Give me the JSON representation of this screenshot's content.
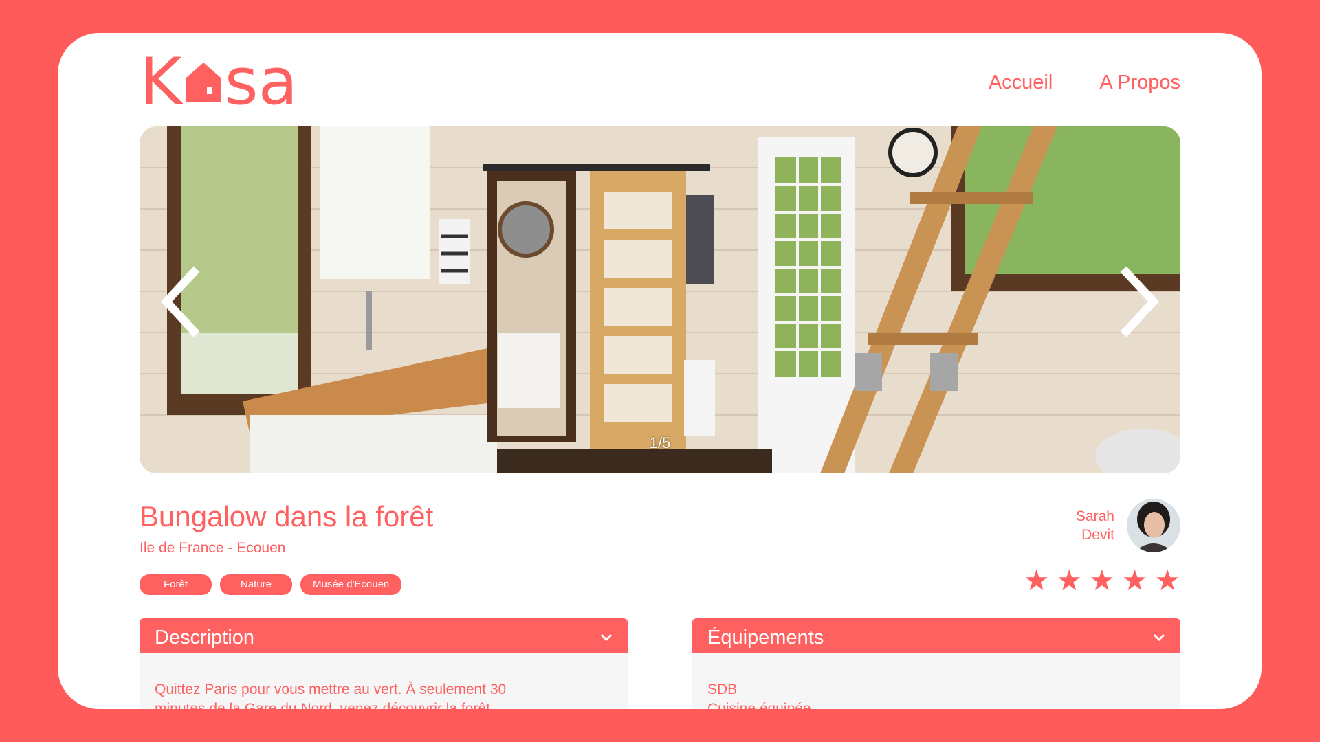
{
  "header": {
    "logo_text": "Kasa",
    "nav": [
      "Accueil",
      "A Propos"
    ]
  },
  "carousel": {
    "counter": "1/5",
    "prev_icon": "chevron-left-icon",
    "next_icon": "chevron-right-icon"
  },
  "listing": {
    "title": "Bungalow dans la forêt",
    "location": "Ile de France - Ecouen",
    "tags": [
      "Forêt",
      "Nature",
      "Musée d'Ecouen"
    ],
    "rating": 5,
    "rating_max": 5
  },
  "host": {
    "first_name": "Sarah",
    "last_name": "Devit"
  },
  "description": {
    "title": "Description",
    "text_line1": "Quittez Paris pour vous mettre au vert. À seulement 30",
    "text_line2": "minutes de la Gare du Nord, venez découvrir la forêt"
  },
  "equipements": {
    "title": "Équipements",
    "items": [
      "SDB",
      "Cuisine équipée"
    ]
  },
  "colors": {
    "brand": "#FF6060",
    "background": "#FF5B5B",
    "panel": "#F6F6F6"
  }
}
